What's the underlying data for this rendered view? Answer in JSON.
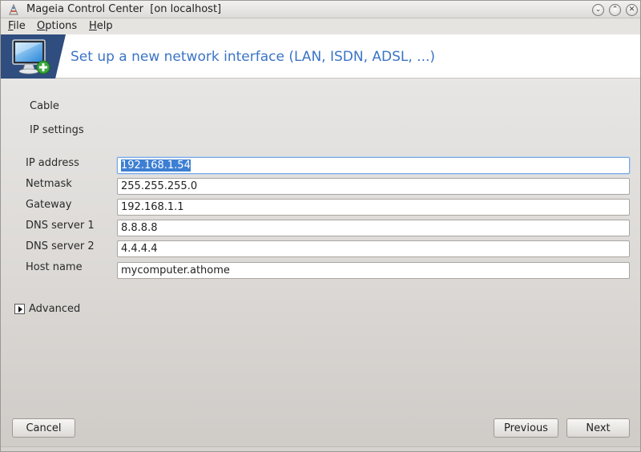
{
  "window": {
    "title": "Mageia Control Center  [on localhost]",
    "controls": {
      "minimize": "⌄",
      "maximize": "⌃",
      "close": "✕"
    }
  },
  "menu": {
    "file": {
      "mnemonic": "F",
      "rest": "ile"
    },
    "options": {
      "mnemonic": "O",
      "rest": "ptions"
    },
    "help": {
      "mnemonic": "H",
      "rest": "elp"
    }
  },
  "banner": {
    "title": "Set up a new network interface (LAN, ISDN, ADSL, ...)",
    "icon": "monitor-add-icon",
    "accent_color": "#3b74c6",
    "icon_bg_color": "#2f4d7e"
  },
  "connection_type": "Cable",
  "section_title": "IP settings",
  "form": {
    "ip_address": {
      "label": "IP address",
      "value": "192.168.1.54"
    },
    "netmask": {
      "label": "Netmask",
      "value": "255.255.255.0"
    },
    "gateway": {
      "label": "Gateway",
      "value": "192.168.1.1"
    },
    "dns1": {
      "label": "DNS server 1",
      "value": "8.8.8.8"
    },
    "dns2": {
      "label": "DNS server 2",
      "value": "4.4.4.4"
    },
    "hostname": {
      "label": "Host name",
      "value": "mycomputer.athome"
    }
  },
  "advanced": {
    "label": "Advanced",
    "icon": "expander-arrow-icon"
  },
  "buttons": {
    "cancel": "Cancel",
    "previous": "Previous",
    "next": "Next"
  },
  "selection_color": "#3d7fd3"
}
